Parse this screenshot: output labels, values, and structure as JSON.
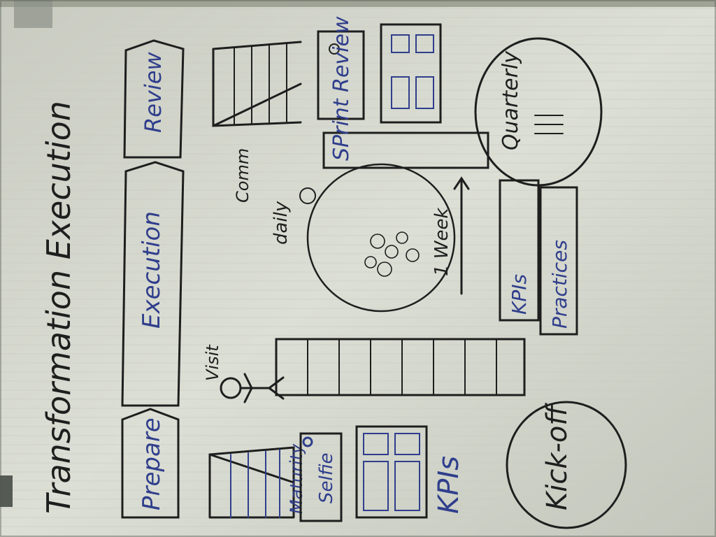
{
  "photo": {
    "title": "Transformation Execution",
    "phases": [
      "Prepare",
      "Execution",
      "Review"
    ],
    "left_column": {
      "ladder_label": "Maturity",
      "selfie_label": "Selfie",
      "dashboard_label": "KPIs"
    },
    "middle": {
      "visit_label": "Visit",
      "cycle_label": "daily",
      "cycle_duration": "1 Week",
      "comm_label": "Comm",
      "sprint_label": "SPrint Review"
    },
    "bottom": {
      "kickoff_label": "Kick-off",
      "kpis_box_label": "KPIs",
      "practices_box_label": "Practices",
      "quarterly_label": "Quarterly"
    },
    "colors": {
      "paper": "#d7d9cf",
      "ink_black": "#1e1e1e",
      "ink_blue": "#2f3e8c",
      "shadow": "#5f6357"
    }
  }
}
